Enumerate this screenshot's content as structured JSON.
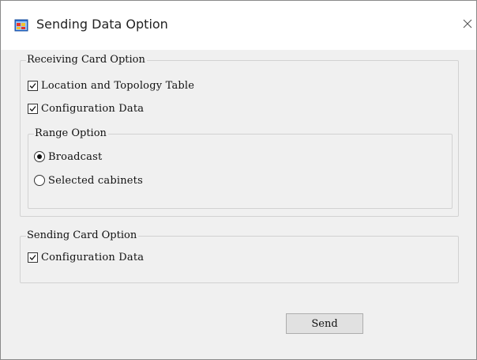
{
  "window": {
    "title": "Sending Data Option",
    "icon": "app-window-icon",
    "close_icon": "close-icon"
  },
  "receiving_card": {
    "legend": "Receiving Card Option",
    "location_topology": {
      "label": "Location and Topology Table",
      "checked": true
    },
    "configuration_data": {
      "label": "Configuration Data",
      "checked": true
    },
    "range_option": {
      "legend": "Range Option",
      "broadcast": {
        "label": "Broadcast",
        "selected": true
      },
      "selected_cabinets": {
        "label": "Selected cabinets",
        "selected": false
      }
    }
  },
  "sending_card": {
    "legend": "Sending Card Option",
    "configuration_data": {
      "label": "Configuration Data",
      "checked": true
    }
  },
  "buttons": {
    "send_label": "Send"
  },
  "colors": {
    "window_bg": "#f0f0f0",
    "titlebar_bg": "#ffffff",
    "group_border": "#d2d2d2",
    "button_bg": "#e1e1e1"
  }
}
